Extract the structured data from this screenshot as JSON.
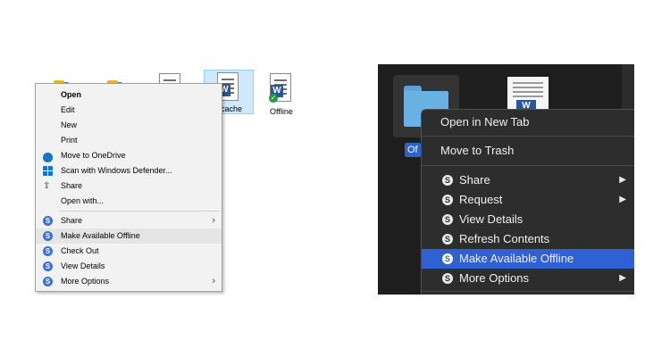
{
  "windows": {
    "file_labels": [
      "cache",
      "Offline"
    ],
    "menu": [
      {
        "label": "Open",
        "bold": true
      },
      {
        "label": "Edit"
      },
      {
        "label": "New"
      },
      {
        "label": "Print"
      },
      {
        "label": "Move to OneDrive",
        "icon": "onedrive-cloud-icon"
      },
      {
        "label": "Scan with Windows Defender...",
        "icon": "windows-defender-icon"
      },
      {
        "label": "Share",
        "icon": "share-icon"
      },
      {
        "label": "Open with..."
      },
      {
        "label": "Share",
        "icon": "s-app-icon",
        "submenu": true
      },
      {
        "label": "Make Available Offline",
        "icon": "s-app-icon",
        "highlighted": true
      },
      {
        "label": "Check Out",
        "icon": "s-app-icon"
      },
      {
        "label": "View Details",
        "icon": "s-app-icon"
      },
      {
        "label": "More Options",
        "icon": "s-app-icon",
        "submenu": true
      }
    ]
  },
  "mac": {
    "folder_label": "Of",
    "menu": [
      {
        "label": "Open in New Tab"
      },
      {
        "label": "Move to Trash"
      },
      {
        "label": "Share",
        "icon": "s-app-icon",
        "submenu": true
      },
      {
        "label": "Request",
        "icon": "s-app-icon",
        "submenu": true
      },
      {
        "label": "View Details",
        "icon": "s-app-icon"
      },
      {
        "label": "Refresh Contents",
        "icon": "s-app-icon"
      },
      {
        "label": "Make Available Offline",
        "icon": "s-app-icon",
        "highlighted": true
      },
      {
        "label": "More Options",
        "icon": "s-app-icon",
        "submenu": true
      }
    ]
  },
  "glyphs": {
    "s_icon": "S",
    "word_icon": "W",
    "check_icon": "✓",
    "win_arrow": "›",
    "mac_arrow": "▶",
    "share_glyph": "⇪"
  },
  "colors": {
    "mac_highlight": "#2f61d4",
    "s_icon_blue": "#3a6fd8",
    "win_menu_bg": "#f2f2f2",
    "mac_menu_bg": "#2d2d2d"
  }
}
